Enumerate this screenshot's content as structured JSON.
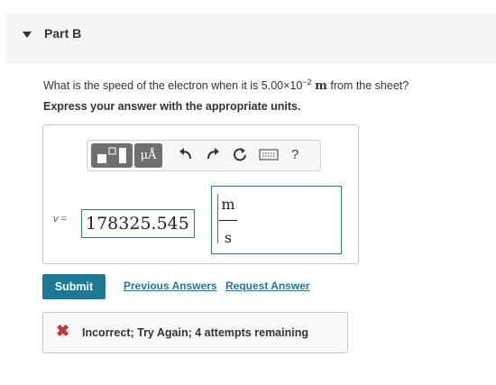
{
  "part": {
    "title": "Part B"
  },
  "question": {
    "prefix": "What is the speed of the electron when it is 5.00×10",
    "exponent": "−2",
    "unit": "m",
    "suffix": "from the sheet?",
    "instruction": "Express your answer with the appropriate units."
  },
  "toolbar": {
    "units_label": "μÅ",
    "undo_icon": "undo-icon",
    "redo_icon": "redo-icon",
    "reset_icon": "reset-icon",
    "keyboard_icon": "keyboard-icon",
    "help_label": "?"
  },
  "answer": {
    "variable": "v",
    "equals": "=",
    "value": "178325.545",
    "unit_numerator": "m",
    "unit_denominator": "s"
  },
  "actions": {
    "submit_label": "Submit",
    "previous_answers_label": "Previous Answers",
    "request_answer_label": "Request Answer"
  },
  "feedback": {
    "icon": "x-icon",
    "message": "Incorrect; Try Again; 4 attempts remaining"
  },
  "colors": {
    "accent": "#1d7a96",
    "error": "#d32f2f"
  }
}
